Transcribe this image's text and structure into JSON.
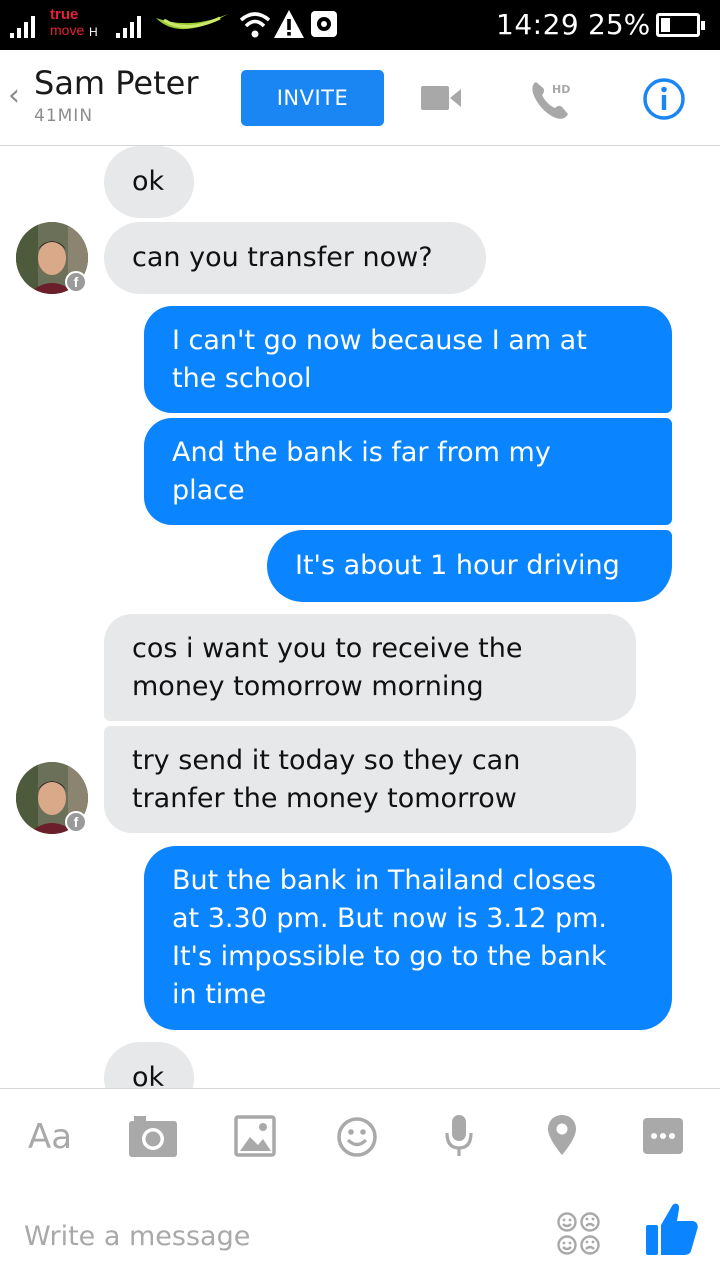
{
  "status_bar": {
    "carrier_top": "true",
    "carrier_bottom": "move",
    "network_type": "H",
    "time": "14:29",
    "battery_percent": "25%",
    "battery_level": 0.25
  },
  "header": {
    "back_glyph": "‹",
    "contact_name": "Sam Peter",
    "last_active": "41MIN",
    "invite_label": "INVITE",
    "icons": [
      "video-camera-icon",
      "hd-phone-icon",
      "info-icon"
    ],
    "hd_label": "HD",
    "accent_color": "#1a86f3"
  },
  "messages": [
    {
      "sender": "contact",
      "text": "ok"
    },
    {
      "sender": "contact",
      "text": "can you transfer now?"
    },
    {
      "sender": "me",
      "text": "I can't go now because I am at\nthe school"
    },
    {
      "sender": "me",
      "text": "And the bank is far from my\nplace"
    },
    {
      "sender": "me",
      "text": "It's about 1 hour driving"
    },
    {
      "sender": "contact",
      "text": "cos i want you to receive the\nmoney tomorrow morning"
    },
    {
      "sender": "contact",
      "text": "try send it today so they can\ntranfer  the money tomorrow"
    },
    {
      "sender": "me",
      "text": "But the bank in Thailand closes\nat 3.30 pm. But now is 3.12 pm.\nIt's impossible to go to the bank\nin time"
    },
    {
      "sender": "contact",
      "text": "ok"
    }
  ],
  "colors": {
    "outgoing_bubble": "#0a84ff",
    "incoming_bubble": "#e7e8ea"
  },
  "composer": {
    "text_tool_label": "Aa",
    "tools": [
      "camera-icon",
      "image-icon",
      "emoji-icon",
      "microphone-icon",
      "location-pin-icon",
      "more-icon"
    ],
    "placeholder": "Write a message",
    "sticker_icon": "stickers-icon",
    "send_icon": "thumbs-up-icon"
  }
}
